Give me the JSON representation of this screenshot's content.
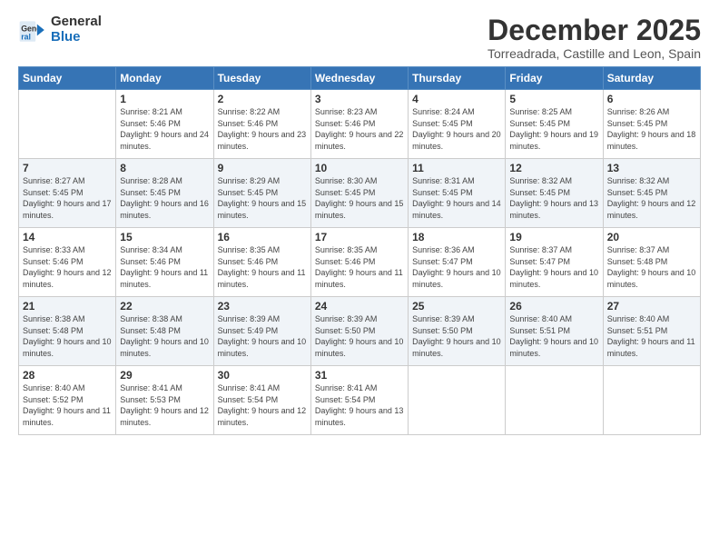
{
  "logo": {
    "general": "General",
    "blue": "Blue"
  },
  "title": "December 2025",
  "location": "Torreadrada, Castille and Leon, Spain",
  "weekdays": [
    "Sunday",
    "Monday",
    "Tuesday",
    "Wednesday",
    "Thursday",
    "Friday",
    "Saturday"
  ],
  "weeks": [
    [
      {
        "day": "",
        "sunrise": "",
        "sunset": "",
        "daylight": ""
      },
      {
        "day": "1",
        "sunrise": "Sunrise: 8:21 AM",
        "sunset": "Sunset: 5:46 PM",
        "daylight": "Daylight: 9 hours and 24 minutes."
      },
      {
        "day": "2",
        "sunrise": "Sunrise: 8:22 AM",
        "sunset": "Sunset: 5:46 PM",
        "daylight": "Daylight: 9 hours and 23 minutes."
      },
      {
        "day": "3",
        "sunrise": "Sunrise: 8:23 AM",
        "sunset": "Sunset: 5:46 PM",
        "daylight": "Daylight: 9 hours and 22 minutes."
      },
      {
        "day": "4",
        "sunrise": "Sunrise: 8:24 AM",
        "sunset": "Sunset: 5:45 PM",
        "daylight": "Daylight: 9 hours and 20 minutes."
      },
      {
        "day": "5",
        "sunrise": "Sunrise: 8:25 AM",
        "sunset": "Sunset: 5:45 PM",
        "daylight": "Daylight: 9 hours and 19 minutes."
      },
      {
        "day": "6",
        "sunrise": "Sunrise: 8:26 AM",
        "sunset": "Sunset: 5:45 PM",
        "daylight": "Daylight: 9 hours and 18 minutes."
      }
    ],
    [
      {
        "day": "7",
        "sunrise": "Sunrise: 8:27 AM",
        "sunset": "Sunset: 5:45 PM",
        "daylight": "Daylight: 9 hours and 17 minutes."
      },
      {
        "day": "8",
        "sunrise": "Sunrise: 8:28 AM",
        "sunset": "Sunset: 5:45 PM",
        "daylight": "Daylight: 9 hours and 16 minutes."
      },
      {
        "day": "9",
        "sunrise": "Sunrise: 8:29 AM",
        "sunset": "Sunset: 5:45 PM",
        "daylight": "Daylight: 9 hours and 15 minutes."
      },
      {
        "day": "10",
        "sunrise": "Sunrise: 8:30 AM",
        "sunset": "Sunset: 5:45 PM",
        "daylight": "Daylight: 9 hours and 15 minutes."
      },
      {
        "day": "11",
        "sunrise": "Sunrise: 8:31 AM",
        "sunset": "Sunset: 5:45 PM",
        "daylight": "Daylight: 9 hours and 14 minutes."
      },
      {
        "day": "12",
        "sunrise": "Sunrise: 8:32 AM",
        "sunset": "Sunset: 5:45 PM",
        "daylight": "Daylight: 9 hours and 13 minutes."
      },
      {
        "day": "13",
        "sunrise": "Sunrise: 8:32 AM",
        "sunset": "Sunset: 5:45 PM",
        "daylight": "Daylight: 9 hours and 12 minutes."
      }
    ],
    [
      {
        "day": "14",
        "sunrise": "Sunrise: 8:33 AM",
        "sunset": "Sunset: 5:46 PM",
        "daylight": "Daylight: 9 hours and 12 minutes."
      },
      {
        "day": "15",
        "sunrise": "Sunrise: 8:34 AM",
        "sunset": "Sunset: 5:46 PM",
        "daylight": "Daylight: 9 hours and 11 minutes."
      },
      {
        "day": "16",
        "sunrise": "Sunrise: 8:35 AM",
        "sunset": "Sunset: 5:46 PM",
        "daylight": "Daylight: 9 hours and 11 minutes."
      },
      {
        "day": "17",
        "sunrise": "Sunrise: 8:35 AM",
        "sunset": "Sunset: 5:46 PM",
        "daylight": "Daylight: 9 hours and 11 minutes."
      },
      {
        "day": "18",
        "sunrise": "Sunrise: 8:36 AM",
        "sunset": "Sunset: 5:47 PM",
        "daylight": "Daylight: 9 hours and 10 minutes."
      },
      {
        "day": "19",
        "sunrise": "Sunrise: 8:37 AM",
        "sunset": "Sunset: 5:47 PM",
        "daylight": "Daylight: 9 hours and 10 minutes."
      },
      {
        "day": "20",
        "sunrise": "Sunrise: 8:37 AM",
        "sunset": "Sunset: 5:48 PM",
        "daylight": "Daylight: 9 hours and 10 minutes."
      }
    ],
    [
      {
        "day": "21",
        "sunrise": "Sunrise: 8:38 AM",
        "sunset": "Sunset: 5:48 PM",
        "daylight": "Daylight: 9 hours and 10 minutes."
      },
      {
        "day": "22",
        "sunrise": "Sunrise: 8:38 AM",
        "sunset": "Sunset: 5:48 PM",
        "daylight": "Daylight: 9 hours and 10 minutes."
      },
      {
        "day": "23",
        "sunrise": "Sunrise: 8:39 AM",
        "sunset": "Sunset: 5:49 PM",
        "daylight": "Daylight: 9 hours and 10 minutes."
      },
      {
        "day": "24",
        "sunrise": "Sunrise: 8:39 AM",
        "sunset": "Sunset: 5:50 PM",
        "daylight": "Daylight: 9 hours and 10 minutes."
      },
      {
        "day": "25",
        "sunrise": "Sunrise: 8:39 AM",
        "sunset": "Sunset: 5:50 PM",
        "daylight": "Daylight: 9 hours and 10 minutes."
      },
      {
        "day": "26",
        "sunrise": "Sunrise: 8:40 AM",
        "sunset": "Sunset: 5:51 PM",
        "daylight": "Daylight: 9 hours and 10 minutes."
      },
      {
        "day": "27",
        "sunrise": "Sunrise: 8:40 AM",
        "sunset": "Sunset: 5:51 PM",
        "daylight": "Daylight: 9 hours and 11 minutes."
      }
    ],
    [
      {
        "day": "28",
        "sunrise": "Sunrise: 8:40 AM",
        "sunset": "Sunset: 5:52 PM",
        "daylight": "Daylight: 9 hours and 11 minutes."
      },
      {
        "day": "29",
        "sunrise": "Sunrise: 8:41 AM",
        "sunset": "Sunset: 5:53 PM",
        "daylight": "Daylight: 9 hours and 12 minutes."
      },
      {
        "day": "30",
        "sunrise": "Sunrise: 8:41 AM",
        "sunset": "Sunset: 5:54 PM",
        "daylight": "Daylight: 9 hours and 12 minutes."
      },
      {
        "day": "31",
        "sunrise": "Sunrise: 8:41 AM",
        "sunset": "Sunset: 5:54 PM",
        "daylight": "Daylight: 9 hours and 13 minutes."
      },
      {
        "day": "",
        "sunrise": "",
        "sunset": "",
        "daylight": ""
      },
      {
        "day": "",
        "sunrise": "",
        "sunset": "",
        "daylight": ""
      },
      {
        "day": "",
        "sunrise": "",
        "sunset": "",
        "daylight": ""
      }
    ]
  ]
}
